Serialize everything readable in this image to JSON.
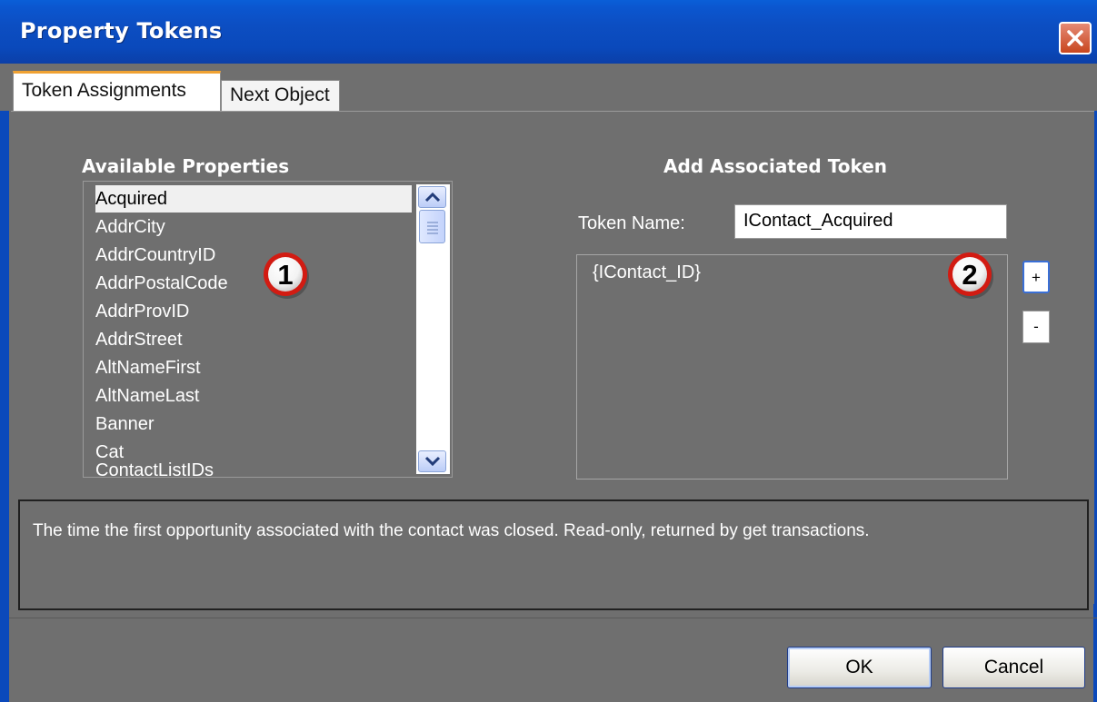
{
  "window": {
    "title": "Property Tokens",
    "close_icon": "close-icon"
  },
  "tabs": [
    {
      "label": "Token Assignments",
      "active": true
    },
    {
      "label": "Next Object",
      "active": false
    }
  ],
  "available": {
    "heading": "Available Properties",
    "items": [
      "Acquired",
      "AddrCity",
      "AddrCountryID",
      "AddrPostalCode",
      "AddrProvID",
      "AddrStreet",
      "AltNameFirst",
      "AltNameLast",
      "Banner",
      "Cat",
      "ContactListIDs"
    ],
    "selected": "Acquired"
  },
  "add_token": {
    "heading": "Add Associated Token",
    "token_name_label": "Token Name:",
    "token_name_value": "IContact_Acquired",
    "tokens": [
      "{IContact_ID}"
    ],
    "add_label": "+",
    "remove_label": "-"
  },
  "callouts": [
    "1",
    "2"
  ],
  "description": "The time the first opportunity associated with the contact was closed. Read-only, returned by get transactions.",
  "buttons": {
    "ok": "OK",
    "cancel": "Cancel"
  },
  "colors": {
    "titlebar": "#0b4fc3",
    "panel": "#6f6f6f",
    "tab_accent": "#f0a233",
    "callout_red": "#d21b12"
  }
}
